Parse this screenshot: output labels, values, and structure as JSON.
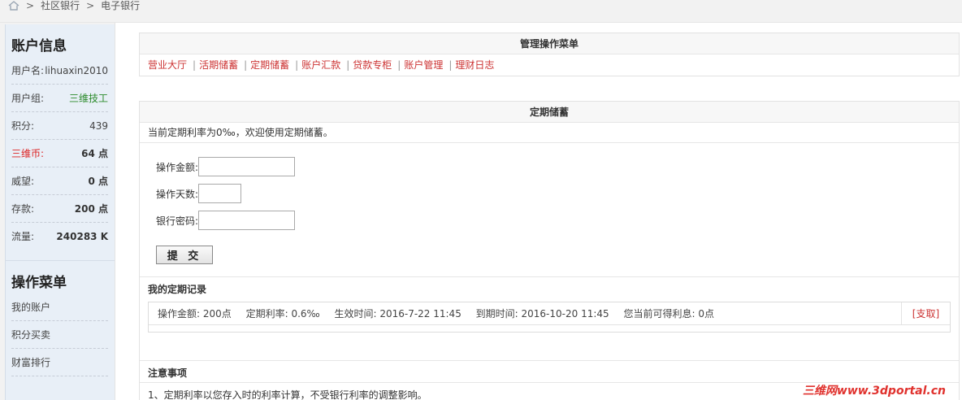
{
  "breadcrumb": {
    "items": [
      "社区银行",
      "电子银行"
    ],
    "separator": ">"
  },
  "sidebar": {
    "account_title": "账户信息",
    "fields": [
      {
        "label": "用户名:",
        "value": "lihuaxin2010"
      },
      {
        "label": "用户组:",
        "value": "三维技工"
      },
      {
        "label": "积分:",
        "value": "439"
      },
      {
        "label": "三维币:",
        "value": "64 点"
      },
      {
        "label": "威望:",
        "value": "0 点"
      },
      {
        "label": "存款:",
        "value": "200 点"
      },
      {
        "label": "流量:",
        "value": "240283 K"
      }
    ],
    "menu_title": "操作菜单",
    "menu": [
      "我的账户",
      "积分买卖",
      "财富排行"
    ]
  },
  "manage": {
    "title": "管理操作菜单",
    "links": [
      "营业大厅",
      "活期储蓄",
      "定期储蓄",
      "账户汇款",
      "贷款专柜",
      "账户管理",
      "理财日志"
    ]
  },
  "deposit": {
    "title": "定期储蓄",
    "rate_text": "当前定期利率为0‰，欢迎使用定期储蓄。",
    "amount_label": "操作金额:",
    "days_label": "操作天数:",
    "password_label": "银行密码:",
    "amount_value": "",
    "days_value": "",
    "password_value": "",
    "submit_label": "提 交",
    "records_title": "我的定期记录",
    "record": {
      "amount": "操作金额: 200点",
      "rate": "定期利率: 0.6‰",
      "start": "生效时间: 2016-7-22 11:45",
      "end": "到期时间: 2016-10-20 11:45",
      "interest": "您当前可得利息: 0点",
      "action": "支取",
      "bracket_open": "[",
      "bracket_close": "]"
    },
    "notice_title": "注意事项",
    "notice_1": "1、定期利率以您存入时的利率计算，不受银行利率的调整影响。"
  },
  "watermark": "三维网www.3dportal.cn",
  "colors": {
    "link": "#cc3333",
    "green": "#2a8a2a",
    "red": "#dd2222"
  }
}
